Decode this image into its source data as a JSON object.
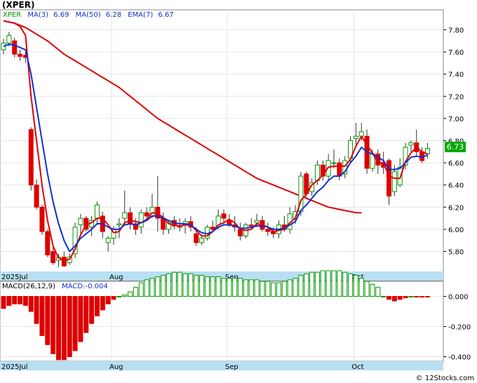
{
  "title": "(XPER)",
  "copyright": "© 12Stocks.com",
  "colors": {
    "up": "#009900",
    "down": "#dd0000",
    "ma3": "#e00000",
    "ma50": "#1030d0",
    "axis_strip": "#b8dff2",
    "grid": "#e6e6e6",
    "price_badge_bg": "#00aa00"
  },
  "legend": {
    "ticker": "XPER",
    "ma3_label": "MA(3)",
    "ma3_value": "6.69",
    "ma50_label": "MA(50)",
    "ma50_value": "6.28",
    "ema7_label": "EMA(7)",
    "ema7_value": "6.67"
  },
  "price_badge": "6.73",
  "macd_legend": {
    "label": "MACD(26,12,9)",
    "value": "MACD:-0.004"
  },
  "chart_data": [
    {
      "type": "candlestick",
      "ylim": [
        5.62,
        7.98
      ],
      "yticks": [
        "7.80",
        "7.60",
        "7.40",
        "7.20",
        "7.00",
        "6.80",
        "6.60",
        "6.40",
        "6.20",
        "6.00",
        "5.80"
      ],
      "month_labels": [
        {
          "label": "2025Jul",
          "index": 0
        },
        {
          "label": "Aug",
          "index": 20
        },
        {
          "label": "Sep",
          "index": 41
        },
        {
          "label": "Oct",
          "index": 64
        }
      ],
      "candles": [
        [
          7.62,
          7.72,
          7.58,
          7.68
        ],
        [
          7.68,
          7.78,
          7.65,
          7.75
        ],
        [
          7.7,
          7.73,
          7.55,
          7.58
        ],
        [
          7.58,
          7.62,
          7.52,
          7.56
        ],
        [
          7.57,
          7.62,
          7.5,
          7.55
        ],
        [
          6.9,
          6.92,
          6.35,
          6.4
        ],
        [
          6.4,
          6.45,
          6.18,
          6.2
        ],
        [
          6.2,
          6.22,
          5.95,
          5.98
        ],
        [
          5.98,
          6.0,
          5.75,
          5.77
        ],
        [
          5.8,
          5.85,
          5.68,
          5.7
        ],
        [
          5.72,
          5.78,
          5.66,
          5.75
        ],
        [
          5.75,
          5.8,
          5.66,
          5.67
        ],
        [
          5.7,
          5.78,
          5.68,
          5.75
        ],
        [
          5.78,
          6.06,
          5.74,
          6.02
        ],
        [
          6.04,
          6.14,
          5.96,
          6.1
        ],
        [
          6.1,
          6.12,
          5.98,
          6.0
        ],
        [
          6.02,
          6.12,
          5.94,
          6.08
        ],
        [
          6.1,
          6.25,
          6.05,
          6.22
        ],
        [
          6.12,
          6.16,
          5.92,
          5.98
        ],
        [
          5.88,
          5.94,
          5.8,
          5.92
        ],
        [
          5.92,
          6.03,
          5.86,
          6.0
        ],
        [
          6.04,
          6.1,
          5.92,
          6.05
        ],
        [
          6.1,
          6.35,
          6.05,
          6.15
        ],
        [
          6.15,
          6.2,
          6.0,
          6.05
        ],
        [
          6.05,
          6.1,
          5.95,
          6.0
        ],
        [
          6.02,
          6.18,
          5.96,
          6.15
        ],
        [
          6.15,
          6.2,
          6.1,
          6.12
        ],
        [
          6.12,
          6.32,
          6.1,
          6.2
        ],
        [
          6.2,
          6.48,
          5.98,
          6.1
        ],
        [
          6.1,
          6.15,
          5.95,
          6.0
        ],
        [
          6.0,
          6.08,
          5.96,
          6.06
        ],
        [
          6.08,
          6.12,
          6.0,
          6.03
        ],
        [
          6.03,
          6.1,
          5.98,
          6.02
        ],
        [
          6.04,
          6.1,
          5.96,
          6.07
        ],
        [
          6.07,
          6.12,
          5.98,
          6.02
        ],
        [
          5.96,
          6.02,
          5.85,
          5.88
        ],
        [
          5.88,
          5.94,
          5.86,
          5.92
        ],
        [
          5.92,
          6.04,
          5.9,
          6.02
        ],
        [
          6.02,
          6.08,
          5.98,
          6.0
        ],
        [
          6.02,
          6.18,
          6.0,
          6.12
        ],
        [
          6.14,
          6.18,
          6.04,
          6.1
        ],
        [
          6.08,
          6.14,
          6.02,
          6.04
        ],
        [
          6.04,
          6.12,
          5.98,
          6.02
        ],
        [
          6.0,
          6.06,
          5.9,
          5.94
        ],
        [
          5.94,
          6.06,
          5.92,
          6.04
        ],
        [
          6.04,
          6.1,
          6.0,
          6.03
        ],
        [
          6.06,
          6.14,
          6.02,
          6.08
        ],
        [
          6.08,
          6.12,
          5.98,
          6.0
        ],
        [
          6.0,
          6.06,
          5.94,
          5.98
        ],
        [
          5.98,
          6.02,
          5.92,
          5.96
        ],
        [
          5.96,
          6.08,
          5.92,
          6.04
        ],
        [
          6.04,
          6.12,
          5.98,
          6.0
        ],
        [
          6.0,
          6.2,
          5.96,
          6.14
        ],
        [
          6.1,
          6.22,
          6.05,
          6.16
        ],
        [
          6.16,
          6.52,
          6.12,
          6.48
        ],
        [
          6.5,
          6.52,
          6.28,
          6.32
        ],
        [
          6.34,
          6.46,
          6.3,
          6.42
        ],
        [
          6.44,
          6.62,
          6.4,
          6.58
        ],
        [
          6.58,
          6.62,
          6.44,
          6.48
        ],
        [
          6.48,
          6.68,
          6.45,
          6.62
        ],
        [
          6.6,
          6.72,
          6.55,
          6.6
        ],
        [
          6.6,
          6.64,
          6.44,
          6.48
        ],
        [
          6.5,
          6.66,
          6.46,
          6.62
        ],
        [
          6.64,
          6.84,
          6.6,
          6.8
        ],
        [
          6.82,
          6.96,
          6.74,
          6.84
        ],
        [
          6.84,
          6.96,
          6.8,
          6.88
        ],
        [
          6.84,
          6.9,
          6.5,
          6.55
        ],
        [
          6.55,
          6.72,
          6.52,
          6.68
        ],
        [
          6.68,
          6.72,
          6.5,
          6.58
        ],
        [
          6.6,
          6.7,
          6.5,
          6.56
        ],
        [
          6.62,
          6.64,
          6.22,
          6.3
        ],
        [
          6.34,
          6.58,
          6.3,
          6.52
        ],
        [
          6.4,
          6.64,
          6.38,
          6.56
        ],
        [
          6.58,
          6.78,
          6.54,
          6.74
        ],
        [
          6.76,
          6.8,
          6.7,
          6.78
        ],
        [
          6.78,
          6.9,
          6.66,
          6.7
        ],
        [
          6.7,
          6.74,
          6.6,
          6.62
        ],
        [
          6.68,
          6.78,
          6.64,
          6.73
        ]
      ],
      "ma3": [
        7.88,
        7.87,
        7.86,
        7.83,
        7.75,
        7.2,
        6.8,
        6.4,
        6.08,
        5.85,
        5.74,
        5.72,
        5.73,
        5.82,
        5.95,
        6.04,
        6.06,
        6.1,
        6.1,
        6.04,
        5.97,
        5.98,
        6.06,
        6.08,
        6.07,
        6.06,
        6.09,
        6.15,
        6.14,
        6.11,
        6.05,
        6.04,
        6.03,
        6.04,
        6.04,
        5.99,
        5.94,
        5.94,
        5.98,
        6.04,
        6.06,
        6.09,
        6.06,
        6.0,
        5.99,
        6.0,
        6.05,
        6.04,
        6.02,
        5.98,
        5.99,
        6.0,
        6.06,
        6.1,
        6.26,
        6.32,
        6.4,
        6.44,
        6.49,
        6.56,
        6.57,
        6.57,
        6.57,
        6.63,
        6.75,
        6.84,
        6.76,
        6.69,
        6.6,
        6.6,
        6.48,
        6.46,
        6.46,
        6.61,
        6.69,
        6.74,
        6.7,
        6.68
      ],
      "ma50": [
        7.88,
        7.87,
        7.86,
        7.84,
        7.82,
        7.79,
        7.76,
        7.73,
        7.7,
        7.66,
        7.62,
        7.58,
        7.55,
        7.52,
        7.49,
        7.46,
        7.43,
        7.4,
        7.37,
        7.34,
        7.31,
        7.28,
        7.24,
        7.2,
        7.16,
        7.12,
        7.08,
        7.04,
        7.0,
        6.97,
        6.94,
        6.91,
        6.88,
        6.85,
        6.82,
        6.79,
        6.76,
        6.73,
        6.7,
        6.67,
        6.64,
        6.61,
        6.58,
        6.55,
        6.52,
        6.49,
        6.46,
        6.44,
        6.42,
        6.4,
        6.38,
        6.36,
        6.34,
        6.32,
        6.3,
        6.28,
        6.26,
        6.24,
        6.22,
        6.2,
        6.19,
        6.18,
        6.17,
        6.16,
        6.15,
        6.15
      ],
      "ema7": [
        7.65,
        7.67,
        7.66,
        7.64,
        7.62,
        7.4,
        7.1,
        6.8,
        6.5,
        6.25,
        6.05,
        5.9,
        5.8,
        5.85,
        5.92,
        5.96,
        6.0,
        6.05,
        6.05,
        6.02,
        6.0,
        6.0,
        6.04,
        6.05,
        6.04,
        6.06,
        6.08,
        6.12,
        6.12,
        6.1,
        6.08,
        6.06,
        6.05,
        6.05,
        6.04,
        6.0,
        5.97,
        5.96,
        5.98,
        6.02,
        6.04,
        6.04,
        6.03,
        6.01,
        6.01,
        6.02,
        6.03,
        6.03,
        6.02,
        6.0,
        6.0,
        6.01,
        6.04,
        6.07,
        6.17,
        6.22,
        6.28,
        6.34,
        6.38,
        6.44,
        6.48,
        6.48,
        6.52,
        6.6,
        6.66,
        6.74,
        6.7,
        6.68,
        6.65,
        6.62,
        6.54,
        6.54,
        6.55,
        6.6,
        6.65,
        6.66,
        6.65,
        6.67
      ]
    },
    {
      "type": "bar",
      "title": "MACD(26,12,9)",
      "ylim": [
        -0.43,
        0.1
      ],
      "yticks": [
        "0.000",
        "-0.200",
        "-0.400"
      ],
      "values": [
        -0.08,
        -0.06,
        -0.05,
        -0.05,
        -0.06,
        -0.1,
        -0.18,
        -0.26,
        -0.32,
        -0.38,
        -0.42,
        -0.42,
        -0.4,
        -0.36,
        -0.3,
        -0.24,
        -0.18,
        -0.13,
        -0.09,
        -0.05,
        -0.02,
        0.0,
        0.01,
        0.03,
        0.06,
        0.09,
        0.11,
        0.12,
        0.13,
        0.14,
        0.15,
        0.16,
        0.16,
        0.15,
        0.15,
        0.14,
        0.14,
        0.13,
        0.13,
        0.13,
        0.12,
        0.12,
        0.12,
        0.12,
        0.11,
        0.11,
        0.11,
        0.1,
        0.1,
        0.09,
        0.09,
        0.1,
        0.11,
        0.12,
        0.14,
        0.15,
        0.16,
        0.16,
        0.17,
        0.17,
        0.17,
        0.17,
        0.16,
        0.15,
        0.14,
        0.12,
        0.1,
        0.08,
        0.06,
        0.0,
        -0.02,
        -0.03,
        -0.02,
        -0.01,
        0.0,
        -0.005,
        -0.004,
        -0.004
      ]
    }
  ]
}
